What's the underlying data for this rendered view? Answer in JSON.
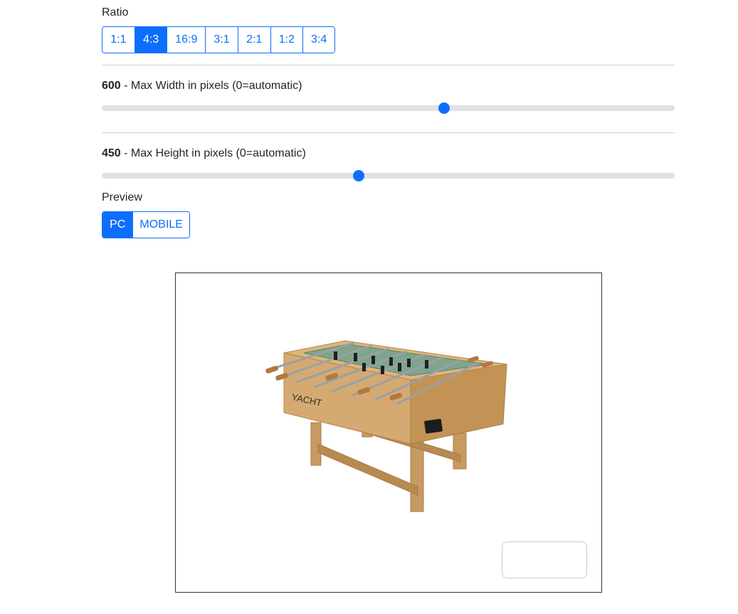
{
  "ratio": {
    "label": "Ratio",
    "options": [
      "1:1",
      "4:3",
      "16:9",
      "3:1",
      "2:1",
      "1:2",
      "3:4"
    ],
    "selected": "4:3"
  },
  "max_width": {
    "value": "600",
    "label": " - Max Width in pixels (0=automatic)",
    "fraction": 0.597
  },
  "max_height": {
    "value": "450",
    "label": " - Max Height in pixels (0=automatic)",
    "fraction": 0.448
  },
  "preview": {
    "label": "Preview",
    "options": [
      "PC",
      "MOBILE"
    ],
    "selected": "PC"
  },
  "model": {
    "brand_text": "YACHT",
    "subject": "foosball-table"
  },
  "colors": {
    "accent": "#0d6efd",
    "track": "#dee2e6",
    "wood": "#c9a06a"
  }
}
